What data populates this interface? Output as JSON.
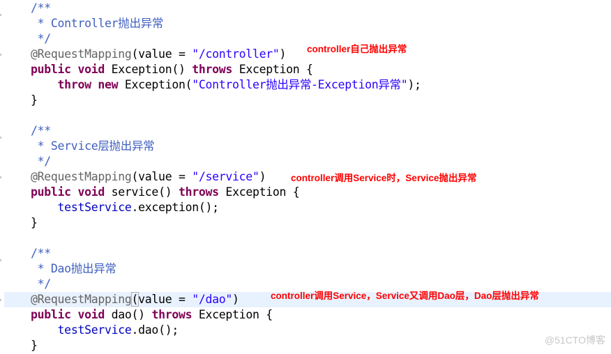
{
  "blocks": [
    {
      "comment_open": "/**",
      "comment_star": " * ",
      "comment_text": "Controller抛出异常",
      "comment_close": " */",
      "annotation": "@RequestMapping",
      "ann_open": "(",
      "ann_key": "value = ",
      "ann_value": "\"/controller\"",
      "ann_close": ")",
      "sig_public": "public",
      "sig_void": "void",
      "sig_rest": " Exception() ",
      "sig_throws": "throws",
      "sig_tail": " Exception {",
      "body_kw1": "throw",
      "body_kw2": "new",
      "body_plain": " Exception(",
      "body_str": "\"Controller抛出异常-Exception异常\"",
      "body_tail": ");",
      "close": "}",
      "note": "controller自己抛出异常"
    },
    {
      "comment_open": "/**",
      "comment_star": " * ",
      "comment_text": "Service层抛出异常",
      "comment_close": " */",
      "annotation": "@RequestMapping",
      "ann_open": "(",
      "ann_key": "value = ",
      "ann_value": "\"/service\"",
      "ann_close": ")",
      "sig_public": "public",
      "sig_void": "void",
      "sig_rest": " service() ",
      "sig_throws": "throws",
      "sig_tail": " Exception {",
      "body_field": "testService",
      "body_call": ".exception();",
      "close": "}",
      "note": "controller调用Service时，Service抛出异常"
    },
    {
      "comment_open": "/**",
      "comment_star": " * ",
      "comment_text": "Dao抛出异常",
      "comment_close": " */",
      "annotation": "@RequestMapping",
      "ann_open": "(",
      "ann_key": "value = ",
      "ann_value": "\"/dao\"",
      "ann_close": ")",
      "sig_public": "public",
      "sig_void": "void",
      "sig_rest": " dao() ",
      "sig_throws": "throws",
      "sig_tail": " Exception {",
      "body_field": "testService",
      "body_call": ".dao();",
      "close": "}",
      "note": "controller调用Service，Service又调用Dao层，Dao层抛出异常"
    }
  ],
  "watermark": "@51CTO博客",
  "colors": {
    "keyword": "#7f0055",
    "string": "#2a00ff",
    "javadoc": "#3f5fbf",
    "annotation": "#646464",
    "field": "#0000c0",
    "note": "#ff0000",
    "current_line": "#e8f2fe"
  }
}
